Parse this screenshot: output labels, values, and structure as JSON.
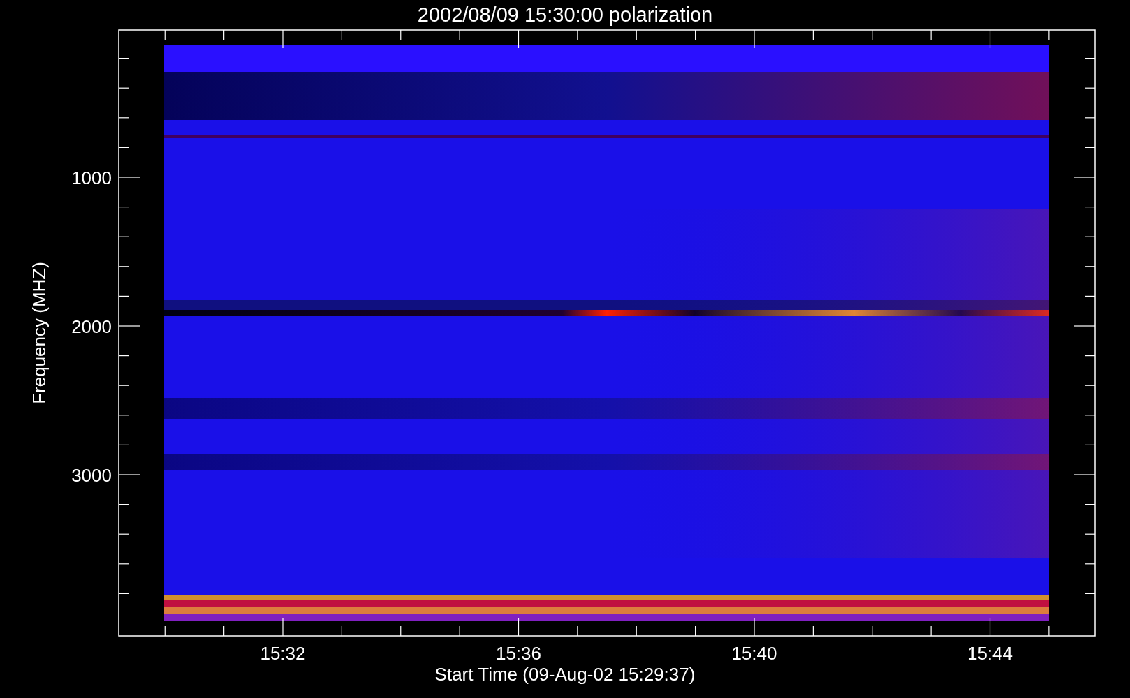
{
  "title": "2002/08/09 15:30:00 polarization",
  "x_axis": {
    "label": "Start Time (09-Aug-02 15:29:37)",
    "ticks": [
      "15:32",
      "15:36",
      "15:40",
      "15:44"
    ]
  },
  "y_axis": {
    "label": "Frequency (MHZ)",
    "ticks": [
      "1000",
      "2000",
      "3000"
    ]
  }
}
